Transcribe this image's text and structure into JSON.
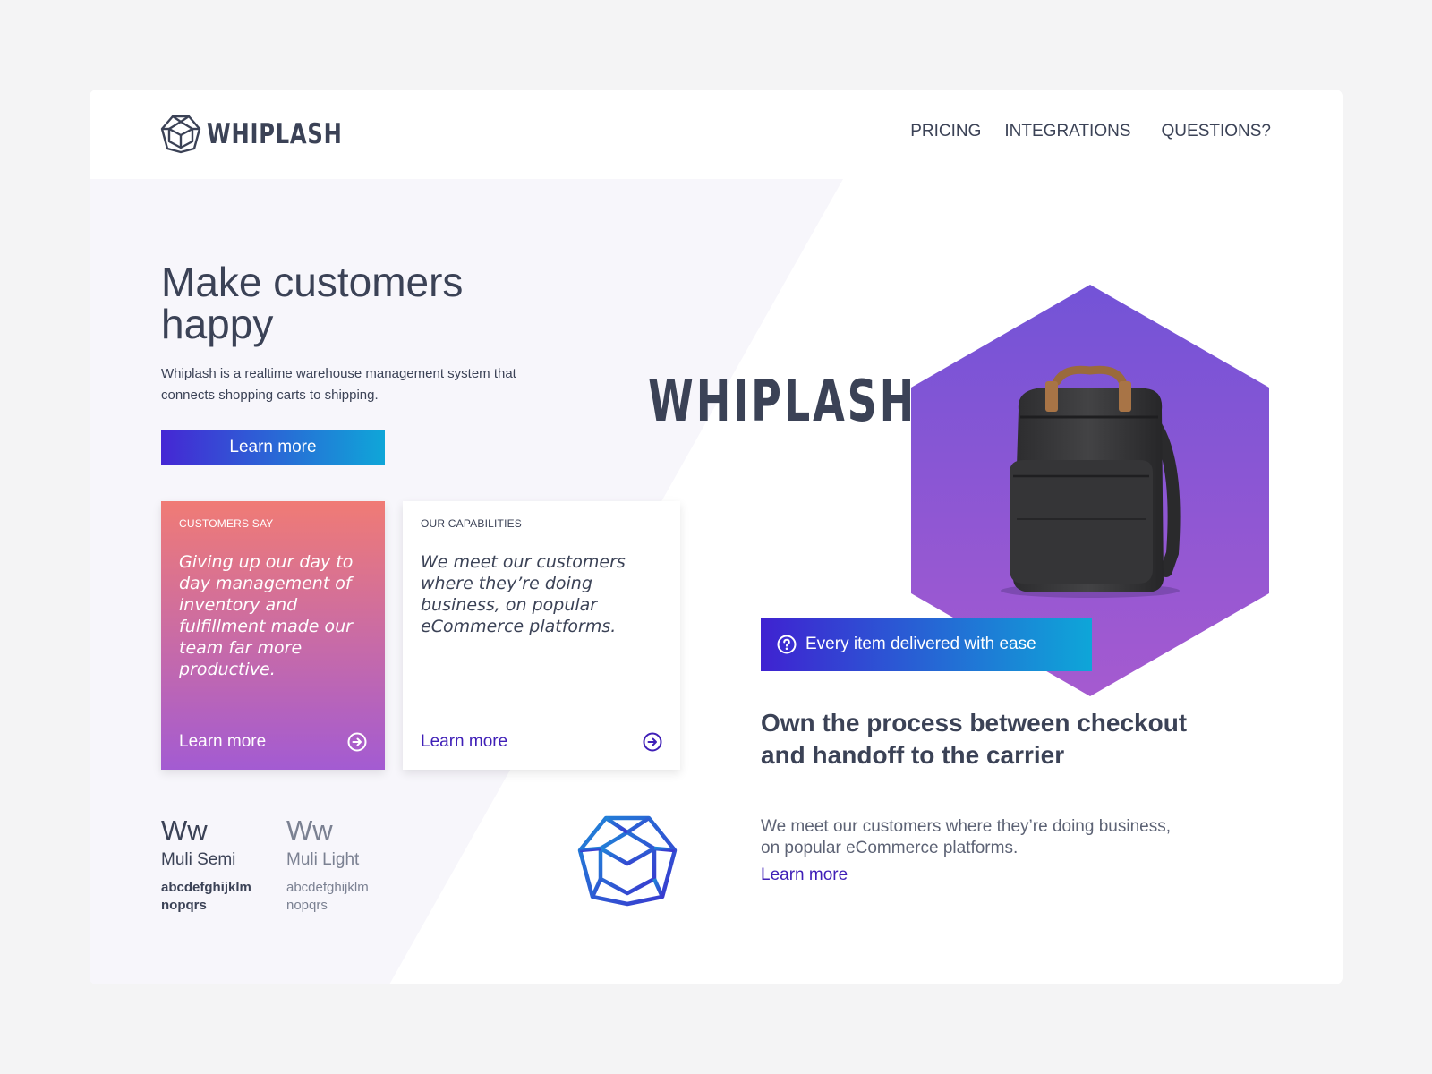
{
  "brand": {
    "name": "WHIPLASH",
    "logo_icon": "hexagon-cube-icon"
  },
  "nav": {
    "items": [
      "PRICING",
      "INTEGRATIONS",
      "QUESTIONS?"
    ]
  },
  "hero": {
    "title": "Make customers happy",
    "subtitle": "Whiplash is a realtime warehouse management system that connects shopping carts to shipping.",
    "cta_label": "Learn more"
  },
  "cards": [
    {
      "eyebrow": "CUSTOMERS SAY",
      "quote": "Giving up our day to day management of inventory and fulfillment made our team far more productive.",
      "link_label": "Learn more",
      "icon": "arrow-circle-right-icon"
    },
    {
      "eyebrow": "OUR CAPABILITIES",
      "quote": "We meet our customers where they’re doing business, on popular eCommerce platforms.",
      "link_label": "Learn more",
      "icon": "arrow-circle-right-icon"
    }
  ],
  "typography": [
    {
      "sample": "Ww",
      "name": "Muli Semi",
      "alphabet": "abcdefghijklm nopqrs"
    },
    {
      "sample": "Ww",
      "name": "Muli Light",
      "alphabet": "abcdefghijklm nopqrs"
    }
  ],
  "showcase": {
    "wordmark": "WHIPLASH",
    "photo": "backpack-product-image",
    "banner_label": "Every item delivered with ease",
    "banner_icon": "question-circle-icon",
    "title": "Own the process between checkout and handoff to the carrier",
    "subtitle": "We meet our customers where they’re doing business, on popular eCommerce platforms.",
    "link_label": "Learn more"
  },
  "colors": {
    "page_bg": "#f4f4f5",
    "text_dark": "#3b4256",
    "accent_purple": "#3f1fb7",
    "gradient_blue_start": "#4527d4",
    "gradient_blue_end": "#0fa6d8",
    "hex_purple": "#7a52d8",
    "card_pink": "#f07b75"
  }
}
